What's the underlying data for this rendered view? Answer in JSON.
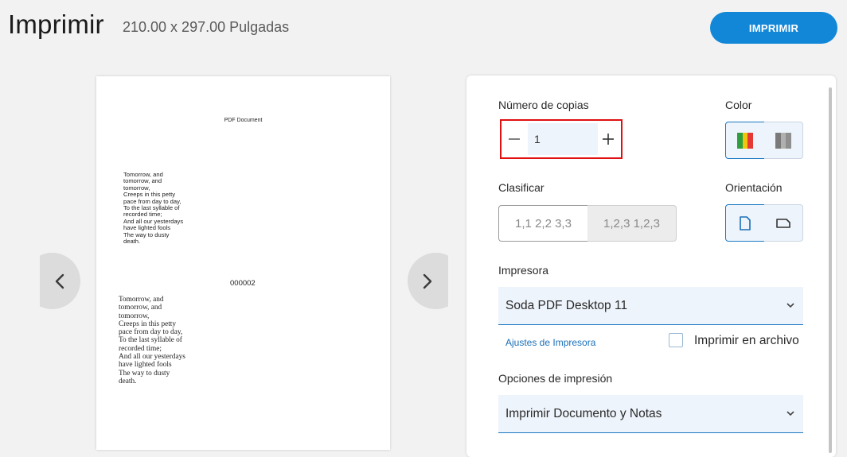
{
  "header": {
    "title": "Imprimir",
    "dimensions": "210.00 x 297.00 Pulgadas",
    "print_button": "IMPRIMIR"
  },
  "preview": {
    "doc_title": "PDF Document",
    "poem_sans": "Tomorrow, and\ntomorrow, and\ntomorrow,\nCreeps in this petty\npace from day to day,\nTo the last syllable of\nrecorded time;\nAnd all our yesterdays\nhave lighted fools\nThe way to dusty\ndeath.",
    "page_number": "000002",
    "poem_serif": "Tomorrow, and\ntomorrow, and\ntomorrow,\nCreeps in this petty\npace from day to day,\nTo the last syllable of\nrecorded time;\nAnd all our yesterdays\nhave lighted fools\nThe way to dusty\ndeath.",
    "prev_icon": "chevron-left-icon",
    "next_icon": "chevron-right-icon"
  },
  "settings": {
    "copies_label": "Número de copias",
    "copies_value": "1",
    "minus_symbol": "—",
    "plus_symbol": "+",
    "color_label": "Color",
    "color_options": [
      "color-icon",
      "grayscale-icon"
    ],
    "color_selected": "color",
    "collate_label": "Clasificar",
    "collate_options": [
      "1,1 2,2 3,3",
      "1,2,3 1,2,3"
    ],
    "orientation_label": "Orientación",
    "orientation_options": [
      "portrait-icon",
      "landscape-icon"
    ],
    "orientation_selected": "portrait",
    "printer_label": "Impresora",
    "printer_value": "Soda PDF Desktop 11",
    "printer_settings_link": "Ajustes de Impresora",
    "print_to_file_label": "Imprimir en archivo",
    "print_to_file_checked": false,
    "options_label": "Opciones de impresión",
    "options_value": "Imprimir Documento y Notas"
  },
  "colors": {
    "accent": "#1287d8",
    "highlight_border": "#e01010",
    "background": "#f2f2f2"
  }
}
